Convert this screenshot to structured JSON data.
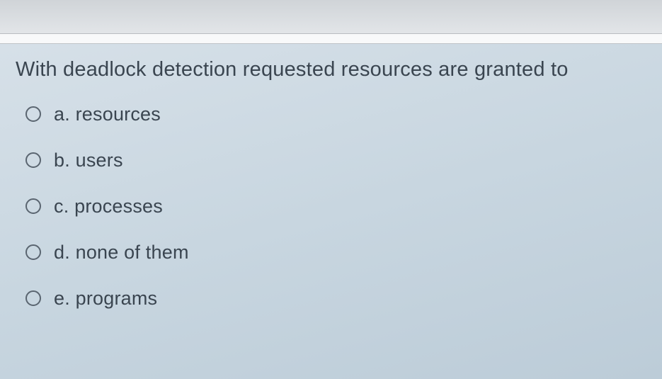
{
  "question": {
    "text": "With deadlock detection requested resources are granted to",
    "options": [
      {
        "letter": "a",
        "label": "a. resources"
      },
      {
        "letter": "b",
        "label": "b. users"
      },
      {
        "letter": "c",
        "label": "c. processes"
      },
      {
        "letter": "d",
        "label": "d. none of them"
      },
      {
        "letter": "e",
        "label": "e. programs"
      }
    ]
  }
}
